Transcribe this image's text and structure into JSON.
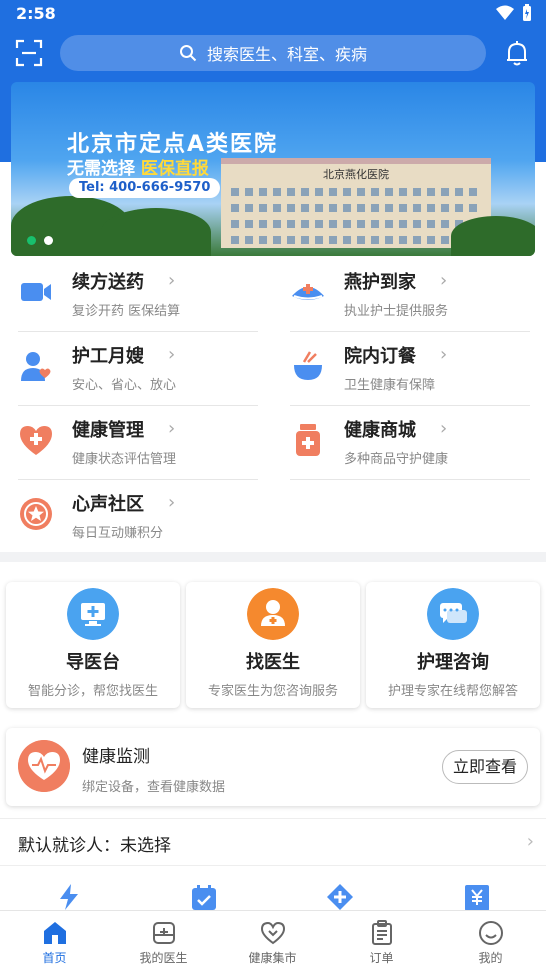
{
  "status_bar": {
    "time": "2:58"
  },
  "search": {
    "placeholder": "搜索医生、科室、疾病"
  },
  "banner": {
    "title": "北京市定点A类医院",
    "subtitle_prefix": "无需选择 ",
    "subtitle_highlight": "医保直报",
    "phone": "Tel: 400-666-9570",
    "hospital_sign": "北京燕化医院",
    "active_slide": 1,
    "slide_count": 2
  },
  "services": [
    {
      "name": "续方送药",
      "desc": "复诊开药 医保结算",
      "icon": "video-camera-icon"
    },
    {
      "name": "燕护到家",
      "desc": "执业护士提供服务",
      "icon": "nurse-cap-icon"
    },
    {
      "name": "护工月嫂",
      "desc": "安心、省心、放心",
      "icon": "caregiver-icon"
    },
    {
      "name": "院内订餐",
      "desc": "卫生健康有保障",
      "icon": "meal-bowl-icon"
    },
    {
      "name": "健康管理",
      "desc": "健康状态评估管理",
      "icon": "heart-plus-icon"
    },
    {
      "name": "健康商城",
      "desc": "多种商品守护健康",
      "icon": "medicine-bottle-icon"
    },
    {
      "name": "心声社区",
      "desc": "每日互动赚积分",
      "icon": "star-badge-icon"
    }
  ],
  "cards": [
    {
      "title": "导医台",
      "desc": "智能分诊，帮您找医生",
      "icon": "monitor-plus-icon",
      "color": "#4aa3f0"
    },
    {
      "title": "找医生",
      "desc": "专家医生为您咨询服务",
      "icon": "doctor-icon",
      "color": "#f5892e"
    },
    {
      "title": "护理咨询",
      "desc": "护理专家在线帮您解答",
      "icon": "chat-bubbles-icon",
      "color": "#4aa3f0"
    }
  ],
  "health_monitor": {
    "title": "健康监测",
    "desc": "绑定设备，查看健康数据",
    "button": "立即查看"
  },
  "default_patient": {
    "label": "默认就诊人：未选择"
  },
  "tabs": [
    {
      "label": "首页",
      "icon": "home-icon",
      "active": true
    },
    {
      "label": "我的医生",
      "icon": "doctor-bag-icon",
      "active": false
    },
    {
      "label": "健康集市",
      "icon": "heart-outline-icon",
      "active": false
    },
    {
      "label": "订单",
      "icon": "clipboard-icon",
      "active": false
    },
    {
      "label": "我的",
      "icon": "smile-icon",
      "active": false
    }
  ],
  "colors": {
    "brand_blue": "#1f6fe0",
    "icon_blue": "#4a8ef0",
    "icon_orange": "#f07e60",
    "active_dot": "#18c06d"
  }
}
